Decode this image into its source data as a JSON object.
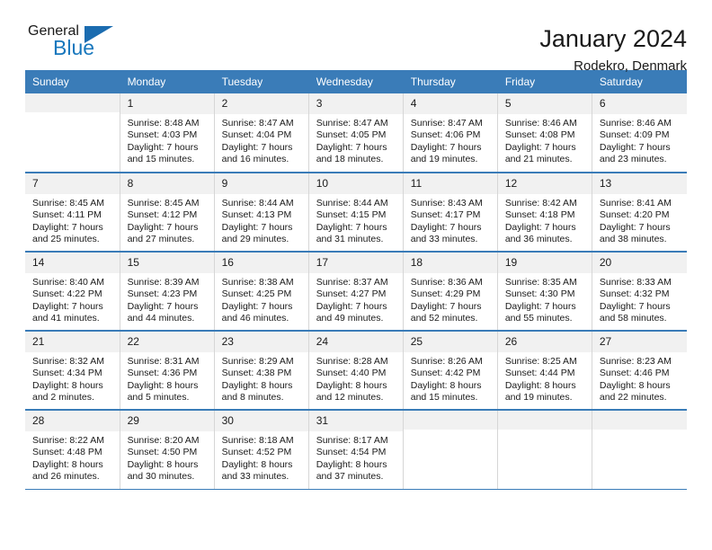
{
  "brand": {
    "name_part1": "General",
    "name_part2": "Blue",
    "triangle_color": "#1b6cb0",
    "blue_color": "#1777bd"
  },
  "header": {
    "title": "January 2024",
    "location": "Rodekro, Denmark",
    "accent_color": "#3a7cb8"
  },
  "calendar": {
    "weekdays": [
      "Sunday",
      "Monday",
      "Tuesday",
      "Wednesday",
      "Thursday",
      "Friday",
      "Saturday"
    ],
    "weeks": [
      [
        {
          "day": "",
          "sunrise": "",
          "sunset": "",
          "daylight_line1": "",
          "daylight_line2": ""
        },
        {
          "day": "1",
          "sunrise": "Sunrise: 8:48 AM",
          "sunset": "Sunset: 4:03 PM",
          "daylight_line1": "Daylight: 7 hours",
          "daylight_line2": "and 15 minutes."
        },
        {
          "day": "2",
          "sunrise": "Sunrise: 8:47 AM",
          "sunset": "Sunset: 4:04 PM",
          "daylight_line1": "Daylight: 7 hours",
          "daylight_line2": "and 16 minutes."
        },
        {
          "day": "3",
          "sunrise": "Sunrise: 8:47 AM",
          "sunset": "Sunset: 4:05 PM",
          "daylight_line1": "Daylight: 7 hours",
          "daylight_line2": "and 18 minutes."
        },
        {
          "day": "4",
          "sunrise": "Sunrise: 8:47 AM",
          "sunset": "Sunset: 4:06 PM",
          "daylight_line1": "Daylight: 7 hours",
          "daylight_line2": "and 19 minutes."
        },
        {
          "day": "5",
          "sunrise": "Sunrise: 8:46 AM",
          "sunset": "Sunset: 4:08 PM",
          "daylight_line1": "Daylight: 7 hours",
          "daylight_line2": "and 21 minutes."
        },
        {
          "day": "6",
          "sunrise": "Sunrise: 8:46 AM",
          "sunset": "Sunset: 4:09 PM",
          "daylight_line1": "Daylight: 7 hours",
          "daylight_line2": "and 23 minutes."
        }
      ],
      [
        {
          "day": "7",
          "sunrise": "Sunrise: 8:45 AM",
          "sunset": "Sunset: 4:11 PM",
          "daylight_line1": "Daylight: 7 hours",
          "daylight_line2": "and 25 minutes."
        },
        {
          "day": "8",
          "sunrise": "Sunrise: 8:45 AM",
          "sunset": "Sunset: 4:12 PM",
          "daylight_line1": "Daylight: 7 hours",
          "daylight_line2": "and 27 minutes."
        },
        {
          "day": "9",
          "sunrise": "Sunrise: 8:44 AM",
          "sunset": "Sunset: 4:13 PM",
          "daylight_line1": "Daylight: 7 hours",
          "daylight_line2": "and 29 minutes."
        },
        {
          "day": "10",
          "sunrise": "Sunrise: 8:44 AM",
          "sunset": "Sunset: 4:15 PM",
          "daylight_line1": "Daylight: 7 hours",
          "daylight_line2": "and 31 minutes."
        },
        {
          "day": "11",
          "sunrise": "Sunrise: 8:43 AM",
          "sunset": "Sunset: 4:17 PM",
          "daylight_line1": "Daylight: 7 hours",
          "daylight_line2": "and 33 minutes."
        },
        {
          "day": "12",
          "sunrise": "Sunrise: 8:42 AM",
          "sunset": "Sunset: 4:18 PM",
          "daylight_line1": "Daylight: 7 hours",
          "daylight_line2": "and 36 minutes."
        },
        {
          "day": "13",
          "sunrise": "Sunrise: 8:41 AM",
          "sunset": "Sunset: 4:20 PM",
          "daylight_line1": "Daylight: 7 hours",
          "daylight_line2": "and 38 minutes."
        }
      ],
      [
        {
          "day": "14",
          "sunrise": "Sunrise: 8:40 AM",
          "sunset": "Sunset: 4:22 PM",
          "daylight_line1": "Daylight: 7 hours",
          "daylight_line2": "and 41 minutes."
        },
        {
          "day": "15",
          "sunrise": "Sunrise: 8:39 AM",
          "sunset": "Sunset: 4:23 PM",
          "daylight_line1": "Daylight: 7 hours",
          "daylight_line2": "and 44 minutes."
        },
        {
          "day": "16",
          "sunrise": "Sunrise: 8:38 AM",
          "sunset": "Sunset: 4:25 PM",
          "daylight_line1": "Daylight: 7 hours",
          "daylight_line2": "and 46 minutes."
        },
        {
          "day": "17",
          "sunrise": "Sunrise: 8:37 AM",
          "sunset": "Sunset: 4:27 PM",
          "daylight_line1": "Daylight: 7 hours",
          "daylight_line2": "and 49 minutes."
        },
        {
          "day": "18",
          "sunrise": "Sunrise: 8:36 AM",
          "sunset": "Sunset: 4:29 PM",
          "daylight_line1": "Daylight: 7 hours",
          "daylight_line2": "and 52 minutes."
        },
        {
          "day": "19",
          "sunrise": "Sunrise: 8:35 AM",
          "sunset": "Sunset: 4:30 PM",
          "daylight_line1": "Daylight: 7 hours",
          "daylight_line2": "and 55 minutes."
        },
        {
          "day": "20",
          "sunrise": "Sunrise: 8:33 AM",
          "sunset": "Sunset: 4:32 PM",
          "daylight_line1": "Daylight: 7 hours",
          "daylight_line2": "and 58 minutes."
        }
      ],
      [
        {
          "day": "21",
          "sunrise": "Sunrise: 8:32 AM",
          "sunset": "Sunset: 4:34 PM",
          "daylight_line1": "Daylight: 8 hours",
          "daylight_line2": "and 2 minutes."
        },
        {
          "day": "22",
          "sunrise": "Sunrise: 8:31 AM",
          "sunset": "Sunset: 4:36 PM",
          "daylight_line1": "Daylight: 8 hours",
          "daylight_line2": "and 5 minutes."
        },
        {
          "day": "23",
          "sunrise": "Sunrise: 8:29 AM",
          "sunset": "Sunset: 4:38 PM",
          "daylight_line1": "Daylight: 8 hours",
          "daylight_line2": "and 8 minutes."
        },
        {
          "day": "24",
          "sunrise": "Sunrise: 8:28 AM",
          "sunset": "Sunset: 4:40 PM",
          "daylight_line1": "Daylight: 8 hours",
          "daylight_line2": "and 12 minutes."
        },
        {
          "day": "25",
          "sunrise": "Sunrise: 8:26 AM",
          "sunset": "Sunset: 4:42 PM",
          "daylight_line1": "Daylight: 8 hours",
          "daylight_line2": "and 15 minutes."
        },
        {
          "day": "26",
          "sunrise": "Sunrise: 8:25 AM",
          "sunset": "Sunset: 4:44 PM",
          "daylight_line1": "Daylight: 8 hours",
          "daylight_line2": "and 19 minutes."
        },
        {
          "day": "27",
          "sunrise": "Sunrise: 8:23 AM",
          "sunset": "Sunset: 4:46 PM",
          "daylight_line1": "Daylight: 8 hours",
          "daylight_line2": "and 22 minutes."
        }
      ],
      [
        {
          "day": "28",
          "sunrise": "Sunrise: 8:22 AM",
          "sunset": "Sunset: 4:48 PM",
          "daylight_line1": "Daylight: 8 hours",
          "daylight_line2": "and 26 minutes."
        },
        {
          "day": "29",
          "sunrise": "Sunrise: 8:20 AM",
          "sunset": "Sunset: 4:50 PM",
          "daylight_line1": "Daylight: 8 hours",
          "daylight_line2": "and 30 minutes."
        },
        {
          "day": "30",
          "sunrise": "Sunrise: 8:18 AM",
          "sunset": "Sunset: 4:52 PM",
          "daylight_line1": "Daylight: 8 hours",
          "daylight_line2": "and 33 minutes."
        },
        {
          "day": "31",
          "sunrise": "Sunrise: 8:17 AM",
          "sunset": "Sunset: 4:54 PM",
          "daylight_line1": "Daylight: 8 hours",
          "daylight_line2": "and 37 minutes."
        },
        {
          "day": "",
          "sunrise": "",
          "sunset": "",
          "daylight_line1": "",
          "daylight_line2": ""
        },
        {
          "day": "",
          "sunrise": "",
          "sunset": "",
          "daylight_line1": "",
          "daylight_line2": ""
        },
        {
          "day": "",
          "sunrise": "",
          "sunset": "",
          "daylight_line1": "",
          "daylight_line2": ""
        }
      ]
    ]
  }
}
